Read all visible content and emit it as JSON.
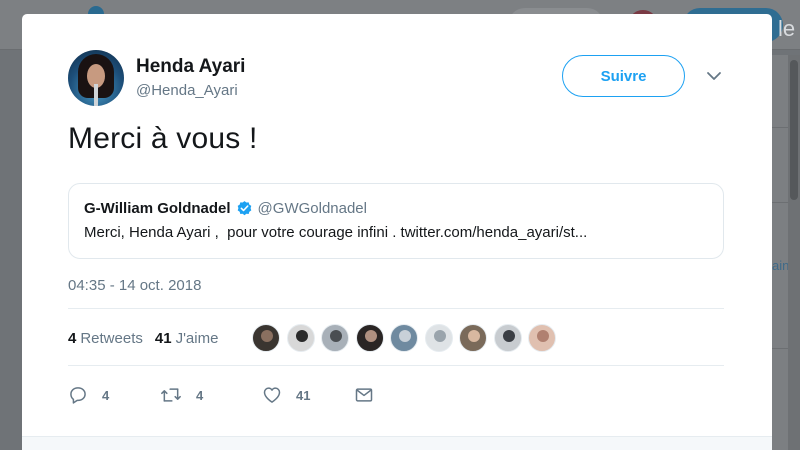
{
  "tweet": {
    "author": {
      "name": "Henda Ayari",
      "handle": "@Henda_Ayari"
    },
    "follow_label": "Suivre",
    "text": "Merci à vous !",
    "quoted": {
      "name": "G-William Goldnadel",
      "handle": "@GWGoldnadel",
      "text": "Merci, Henda Ayari ,  pour votre courage infini . twitter.com/henda_ayari/st..."
    },
    "timestamp": "04:35 - 14 oct. 2018",
    "stats": {
      "retweets_count": "4",
      "retweets_label": "Retweets",
      "likes_count": "41",
      "likes_label": "J'aime"
    },
    "actions": {
      "reply_count": "4",
      "retweet_count": "4",
      "like_count": "41"
    },
    "liker_avatar_count": 9
  },
  "background": {
    "right_text": "ain",
    "right_glyph": "le"
  },
  "colors": {
    "accent": "#1da1f2",
    "secondary_text": "#657786",
    "primary_text": "#14171a",
    "border": "#e1e8ed"
  }
}
